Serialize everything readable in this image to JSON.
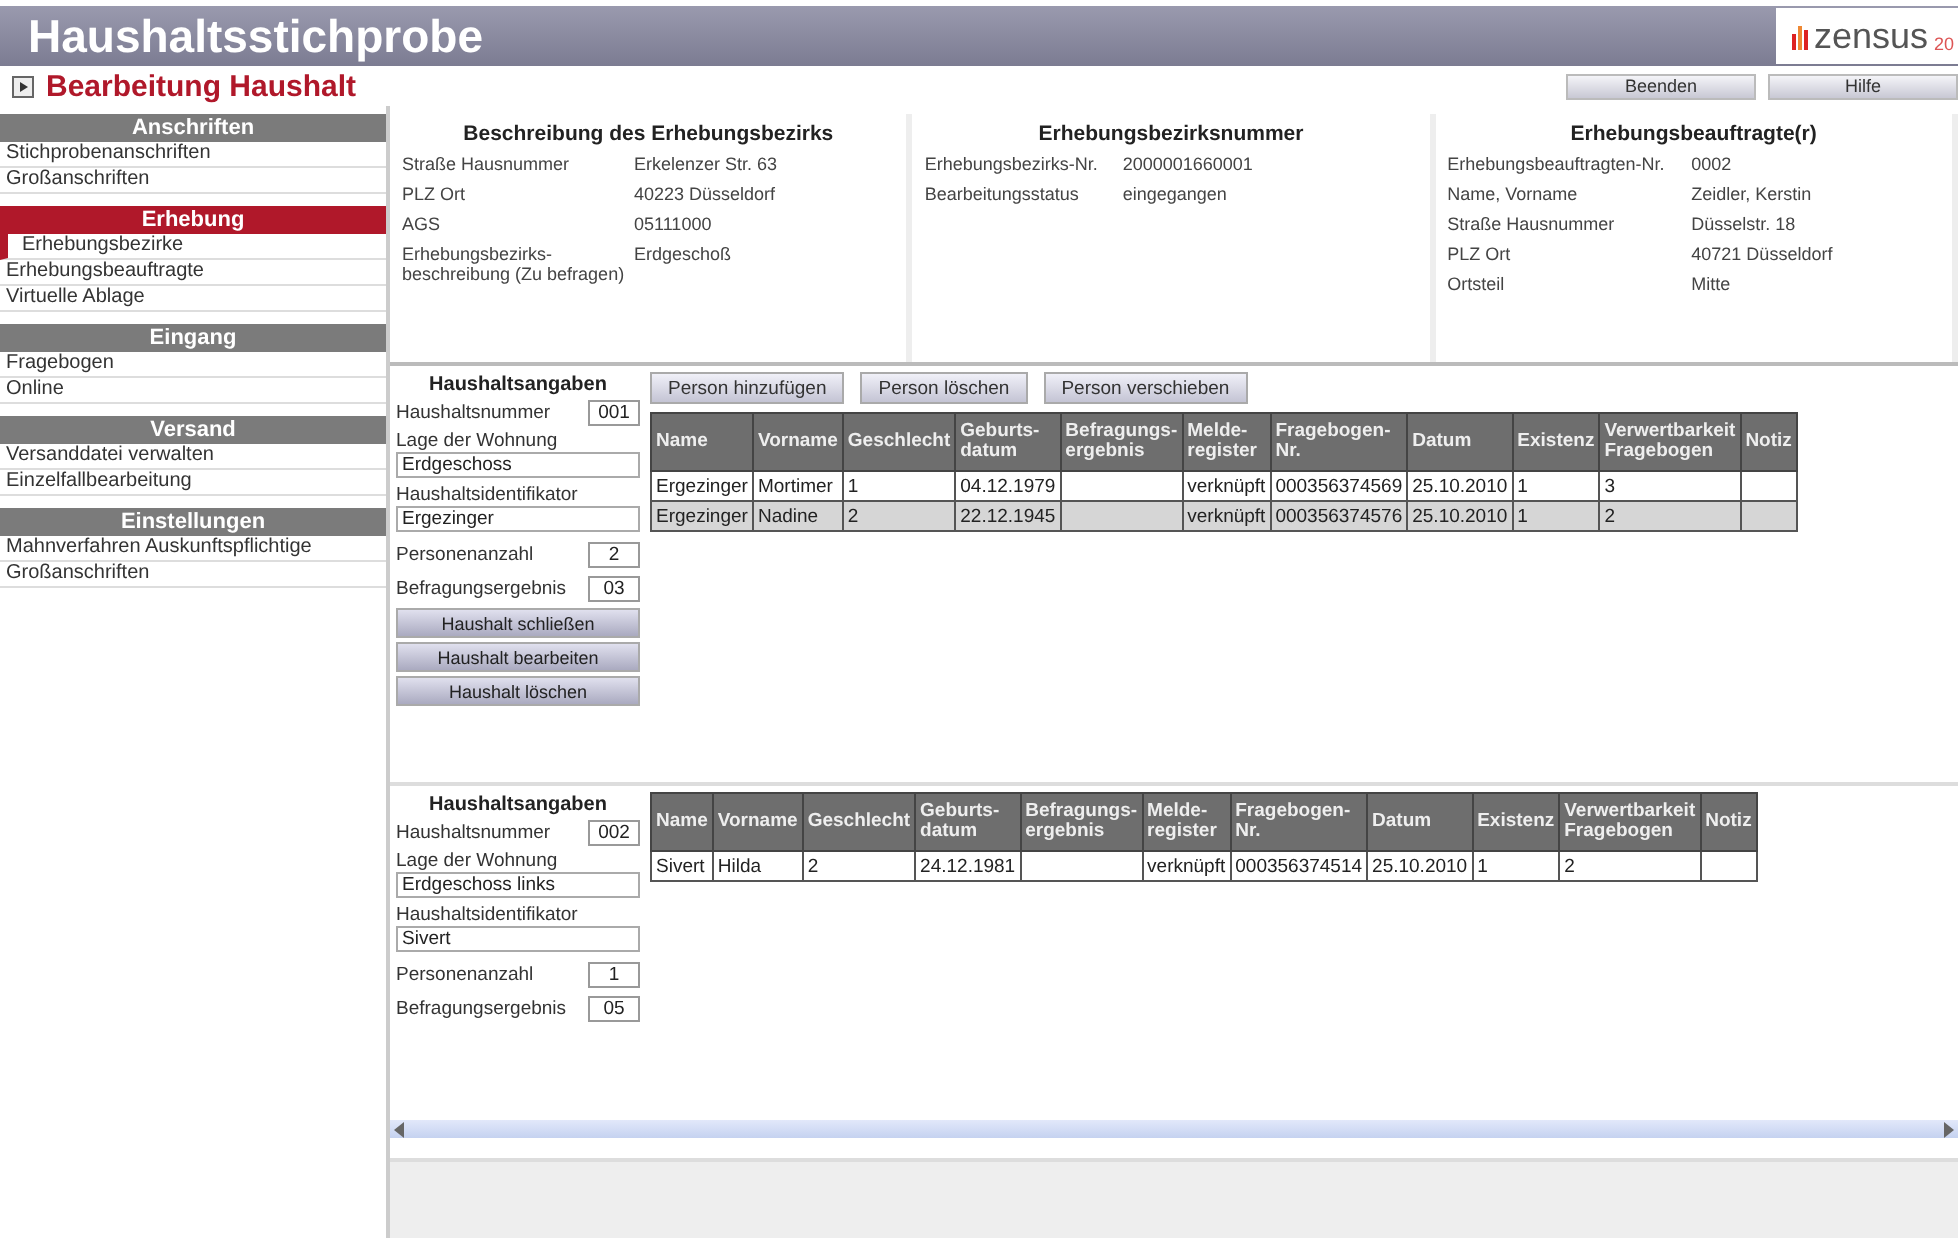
{
  "app_title": "Haushaltsstichprobe",
  "logo": {
    "word": "zensus",
    "suffix": "20"
  },
  "page_title": "Bearbeitung Haushalt",
  "top_buttons": [
    "Beenden",
    "Hilfe"
  ],
  "sidebar": {
    "sections": [
      {
        "title": "Anschriften",
        "selected": false,
        "items": [
          {
            "label": "Stichprobenanschriften",
            "selected": false
          },
          {
            "label": "Großanschriften",
            "selected": false
          }
        ]
      },
      {
        "title": "Erhebung",
        "selected": true,
        "items": [
          {
            "label": "Erhebungsbezirke",
            "selected": true
          },
          {
            "label": "Erhebungsbeauftragte",
            "selected": false
          },
          {
            "label": "Virtuelle Ablage",
            "selected": false
          }
        ]
      },
      {
        "title": "Eingang",
        "selected": false,
        "items": [
          {
            "label": "Fragebogen",
            "selected": false
          },
          {
            "label": "Online",
            "selected": false
          }
        ]
      },
      {
        "title": "Versand",
        "selected": false,
        "items": [
          {
            "label": "Versanddatei verwalten",
            "selected": false
          },
          {
            "label": "Einzelfallbearbeitung",
            "selected": false
          }
        ]
      },
      {
        "title": "Einstellungen",
        "selected": false,
        "items": [
          {
            "label": "Mahnverfahren Auskunftspflichtige",
            "selected": false
          },
          {
            "label": "Großanschriften",
            "selected": false
          }
        ]
      }
    ]
  },
  "info_panels": [
    {
      "title": "Beschreibung des Erhebungsbezirks",
      "rows": [
        {
          "label": "Straße Hausnummer",
          "value": "Erkelenzer Str. 63"
        },
        {
          "label": "PLZ Ort",
          "value": "40223 Düsseldorf"
        },
        {
          "label": "AGS",
          "value": "05111000"
        },
        {
          "label": "Erhebungsbezirks-beschreibung (Zu befragen)",
          "value": "Erdgeschoß"
        }
      ]
    },
    {
      "title": "Erhebungsbezirksnummer",
      "rows": [
        {
          "label": "Erhebungsbezirks-Nr.",
          "value": "2000001660001"
        },
        {
          "label": "Bearbeitungsstatus",
          "value": "eingegangen"
        }
      ]
    },
    {
      "title": "Erhebungsbeauftragte(r)",
      "rows": [
        {
          "label": "Erhebungsbeauftragten-Nr.",
          "value": "0002"
        },
        {
          "label": "Name, Vorname",
          "value": "Zeidler, Kerstin"
        },
        {
          "label": "Straße Hausnummer",
          "value": "Düsselstr. 18"
        },
        {
          "label": "PLZ Ort",
          "value": "40721 Düsseldorf"
        },
        {
          "label": "Ortsteil",
          "value": "Mitte"
        }
      ]
    }
  ],
  "households": [
    {
      "heading": "Haushaltsangaben",
      "fields": [
        {
          "kind": "inline",
          "label": "Haushaltsnummer",
          "value": "001"
        },
        {
          "kind": "block",
          "label": "Lage der Wohnung",
          "value": "Erdgeschoss"
        },
        {
          "kind": "block",
          "label": "Haushaltsidentifikator",
          "value": "Ergezinger"
        },
        {
          "kind": "inline",
          "label": "Personenanzahl",
          "value": "2"
        },
        {
          "kind": "inline",
          "label": "Befragungsergebnis",
          "value": "03"
        }
      ],
      "buttons": [
        "Haushalt schließen",
        "Haushalt bearbeiten",
        "Haushalt löschen"
      ],
      "person_buttons": [
        "Person hinzufügen",
        "Person löschen",
        "Person verschieben"
      ],
      "columns": [
        "Name",
        "Vorname",
        "Geschlecht",
        "Geburts-datum",
        "Befragungs-ergebnis",
        "Melde-register",
        "Fragebogen-Nr.",
        "Datum",
        "Existenz",
        "Verwertbarkeit Fragebogen",
        "Notiz"
      ],
      "rows": [
        {
          "selected": false,
          "cells": [
            "Ergezinger",
            "Mortimer",
            "1",
            "04.12.1979",
            "",
            "verknüpft",
            "000356374569",
            "25.10.2010",
            "1",
            "3",
            ""
          ]
        },
        {
          "selected": true,
          "cells": [
            "Ergezinger",
            "Nadine",
            "2",
            "22.12.1945",
            "",
            "verknüpft",
            "000356374576",
            "25.10.2010",
            "1",
            "2",
            ""
          ]
        }
      ]
    },
    {
      "heading": "Haushaltsangaben",
      "fields": [
        {
          "kind": "inline",
          "label": "Haushaltsnummer",
          "value": "002"
        },
        {
          "kind": "block",
          "label": "Lage der Wohnung",
          "value": "Erdgeschoss links"
        },
        {
          "kind": "block",
          "label": "Haushaltsidentifikator",
          "value": "Sivert"
        },
        {
          "kind": "inline",
          "label": "Personenanzahl",
          "value": "1"
        },
        {
          "kind": "inline",
          "label": "Befragungsergebnis",
          "value": "05"
        }
      ],
      "columns": [
        "Name",
        "Vorname",
        "Geschlecht",
        "Geburts-datum",
        "Befragungs-ergebnis",
        "Melde-register",
        "Fragebogen-Nr.",
        "Datum",
        "Existenz",
        "Verwertbarkeit Fragebogen",
        "Notiz"
      ],
      "rows": [
        {
          "selected": false,
          "cells": [
            "Sivert",
            "Hilda",
            "2",
            "24.12.1981",
            "",
            "verknüpft",
            "000356374514",
            "25.10.2010",
            "1",
            "2",
            ""
          ]
        }
      ]
    }
  ]
}
